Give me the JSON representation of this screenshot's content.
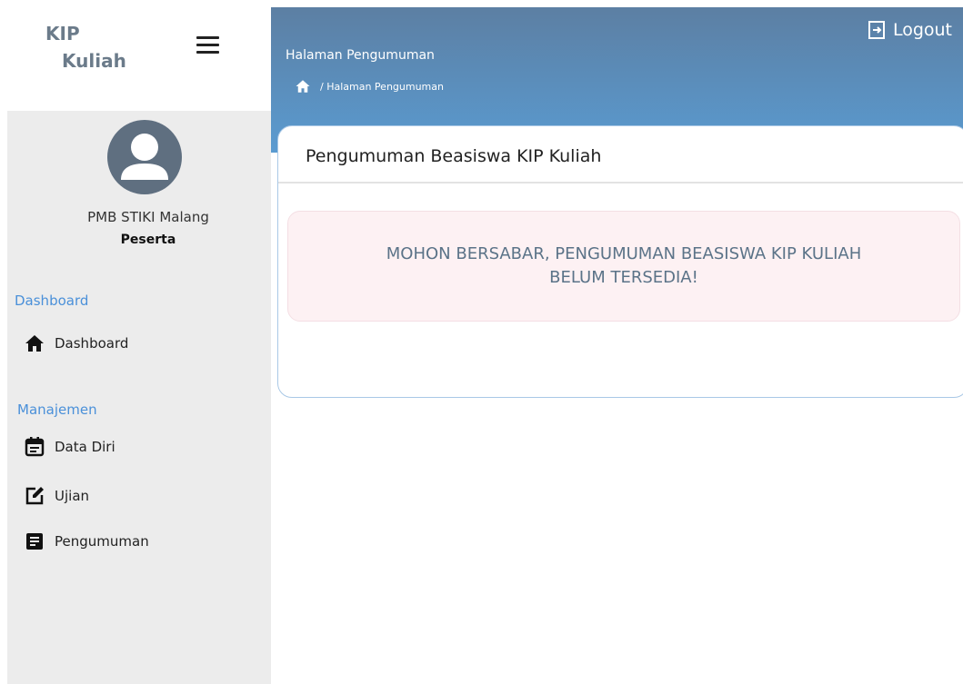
{
  "brand": {
    "line1": "KIP",
    "line2": "Kuliah"
  },
  "user": {
    "name": "PMB STIKI Malang",
    "role": "Peserta"
  },
  "sidebar": {
    "sections": [
      {
        "label": "Dashboard",
        "items": [
          {
            "label": "Dashboard",
            "icon": "home-icon"
          }
        ]
      },
      {
        "label": "Manajemen",
        "items": [
          {
            "label": "Data Diri",
            "icon": "calendar-icon"
          },
          {
            "label": "Ujian",
            "icon": "edit-icon"
          },
          {
            "label": "Pengumuman",
            "icon": "document-icon"
          }
        ]
      }
    ]
  },
  "header": {
    "page_title": "Halaman Pengumuman",
    "breadcrumb": "/ Halaman Pengumuman",
    "logout_label": "Logout"
  },
  "card": {
    "title": "Pengumuman Beasiswa KIP Kuliah",
    "message": "MOHON BERSABAR, PENGUMUMAN BEASISWA KIP KULIAH BELUM TERSEDIA!"
  },
  "colors": {
    "header_top": "#5c7fa3",
    "header_bottom": "#5a9bd1",
    "sidebar_bg": "#ececec",
    "section_label": "#4a90d9",
    "alert_bg": "#fdf1f3",
    "alert_text": "#5b7388"
  }
}
